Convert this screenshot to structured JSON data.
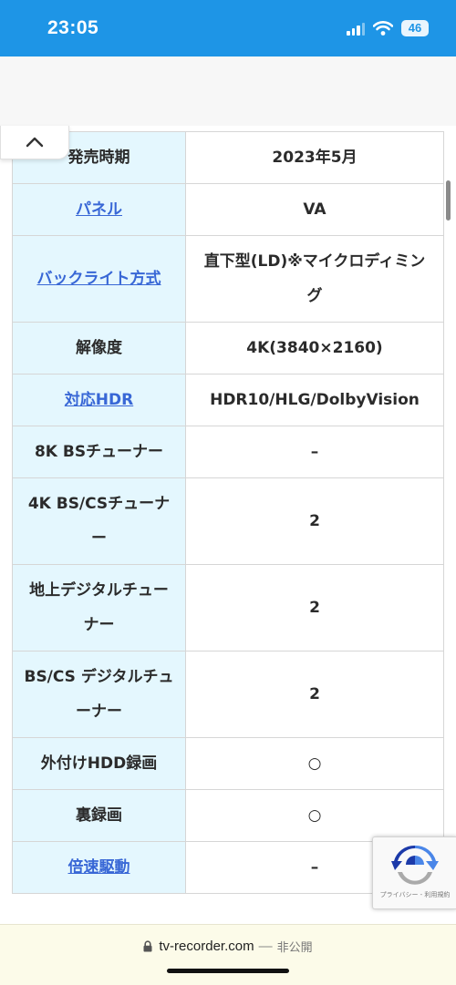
{
  "status_bar": {
    "time": "23:05",
    "battery": "46",
    "icons": [
      "signal-icon",
      "wifi-icon",
      "battery-icon"
    ]
  },
  "spec_rows": [
    {
      "label": "発売時期",
      "value": "2023年5月",
      "link": false
    },
    {
      "label": "パネル",
      "value": "VA",
      "link": true
    },
    {
      "label": "バックライト方式",
      "value": "直下型(LD)※マイクロディミング",
      "link": true
    },
    {
      "label": "解像度",
      "value": "4K(3840×2160)",
      "link": false
    },
    {
      "label": "対応HDR",
      "value": "HDR10/HLG/DolbyVision",
      "link": true
    },
    {
      "label": "8K BSチューナー",
      "value": "–",
      "link": false
    },
    {
      "label": "4K BS/CSチューナー",
      "value": "2",
      "link": false
    },
    {
      "label": "地上デジタルチューナー",
      "value": "2",
      "link": false
    },
    {
      "label": "BS/CS デジタルチューナー",
      "value": "2",
      "link": false
    },
    {
      "label": "外付けHDD録画",
      "value": "○",
      "link": false
    },
    {
      "label": "裏録画",
      "value": "○",
      "link": false
    },
    {
      "label": "倍速駆動",
      "value": "–",
      "link": true
    }
  ],
  "recaptcha": {
    "text": "プライバシー - 利用規約"
  },
  "address_bar": {
    "url": "tv-recorder.com",
    "separator": "—",
    "status": "非公開"
  },
  "colors": {
    "status_bar_bg": "#1e95e6",
    "label_cell_bg": "#e4f7fe",
    "link": "#3867d6",
    "address_bar_bg": "#fcfbe9"
  }
}
